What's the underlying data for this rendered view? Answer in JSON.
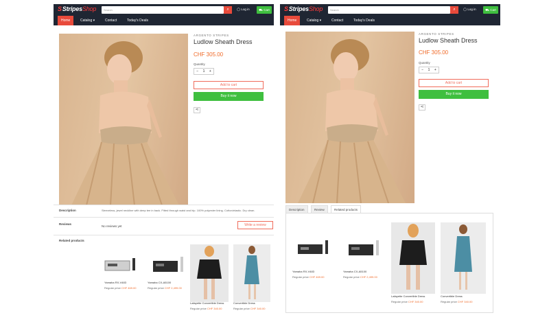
{
  "header": {
    "logo": "StripesShop",
    "logo_stripes": "Stripes",
    "logo_shop": "Shop",
    "search_placeholder": "Search",
    "login": "Log in",
    "cart": "Cart"
  },
  "nav": {
    "home": "Home",
    "catalog": "Catalog",
    "contact": "Contact",
    "deals": "Today's Deals"
  },
  "product": {
    "brand": "ARGENTO STRIPES",
    "title": "Ludlow Sheath Dress",
    "price": "CHF 305.00",
    "quantity_label": "Quantity",
    "quantity": "1",
    "add_to_cart": "Add to cart",
    "buy_now": "Buy it now"
  },
  "left": {
    "description_label": "Description",
    "description_text": "Sleeveless, jewel neckline with deep tee in back. Fitted through waist and hip. 100% polyester lining. Cotton/elastic. Dry clean.",
    "reviews_label": "Reviews",
    "no_reviews": "No reviews yet",
    "write_review": "Write a review",
    "related_label": "Related products"
  },
  "right": {
    "tabs": [
      "Description",
      "Review",
      "Related products"
    ]
  },
  "related": [
    {
      "name": "Yamaha RX-V483",
      "price_prefix": "Regular price",
      "price": "CHF 469.00"
    },
    {
      "name": "Yamaha CX-A5100",
      "price_prefix": "Regular price",
      "price": "CHF 2,499.00"
    },
    {
      "name": "Lafayette Convertible Dress",
      "price_prefix": "Regular price",
      "price": "CHF 340.00"
    },
    {
      "name": "Convertible Dress",
      "price_prefix": "Regular price",
      "price": "CHF 340.00"
    }
  ],
  "colors": {
    "accent": "#e84a3b",
    "price": "#f06b2a",
    "buy": "#3fbf3f",
    "header": "#1f2633"
  }
}
